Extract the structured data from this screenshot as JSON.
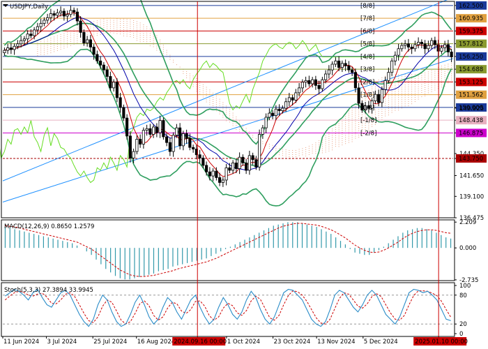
{
  "header": {
    "symbol_title": "USDJPY,Daily",
    "macd_label": "MACD(12,26,9) 0.8650 1.2579",
    "stoch_label": "Stoch(5,3,3) 27.3894 33.9945"
  },
  "colors": {
    "candle": "#000000",
    "bb": "#2e9e5e",
    "ma_fast": "#cc0000",
    "ma_slow": "#0000aa",
    "channel": "#1e90ff",
    "chikou": "#66dd22",
    "cloud": "#e8a080",
    "macd_hist": "#3399aa",
    "macd_signal": "#cc0000",
    "stoch_main": "#2a8cc8",
    "stoch_signal": "#cc0000",
    "vline": "#cc0000"
  },
  "chart_data": [
    {
      "type": "candlestick",
      "title": "USDJPY,Daily",
      "ylim": [
        136.475,
        163.0
      ],
      "price_ticks": [
        "162.500",
        "160.935",
        "159.375",
        "157.812",
        "156.250",
        "154.688",
        "153.125",
        "151.562",
        "150.000",
        "149.925",
        "148.438",
        "146.875",
        "144.350",
        "143.750",
        "141.650",
        "139.100",
        "136.475"
      ],
      "x_ticks": [
        "11 Jun 2024",
        "3 Jul 2024",
        "25 Jul 2024",
        "16 Aug 2024",
        "2024.09.16 00:00",
        "1 Oct 2024",
        "23 Oct 2024",
        "13 Nov 2024",
        "5 Dec 2024",
        "2025.01.10 00:00"
      ],
      "highlighted_times": [
        "2024.09.16 00:00",
        "2025.01.10 00:00"
      ],
      "highlighted_price": "156.250",
      "murrey_levels": [
        {
          "label": "[8/8]",
          "price": 162.5,
          "price_label": "162.500",
          "color": "#1a3a9a"
        },
        {
          "label": "[7/8]",
          "price": 160.935,
          "price_label": "160.935",
          "color": "#e0a040"
        },
        {
          "label": "[6/8]",
          "price": 159.375,
          "price_label": "159.375",
          "color": "#cc0000"
        },
        {
          "label": "[5/8]",
          "price": 157.812,
          "price_label": "157.812",
          "color": "#8a9a30"
        },
        {
          "label": "[4/8]",
          "price": 156.25,
          "price_label": "156.250",
          "color": "#1a3a9a"
        },
        {
          "label": "[3/8]",
          "price": 154.688,
          "price_label": "154.688",
          "color": "#8a9a30"
        },
        {
          "label": "[2/8]",
          "price": 153.125,
          "price_label": "153.125",
          "color": "#cc0000"
        },
        {
          "label": "[1/8]",
          "price": 151.562,
          "price_label": "151.562",
          "color": "#e0a040"
        },
        {
          "label": "[0/8]",
          "price": 150.0,
          "price_label": "150.000",
          "color": "#1a3a9a"
        },
        {
          "label": "[-1/8]",
          "price": 148.438,
          "price_label": "148.438",
          "color": "#e8b0c0"
        },
        {
          "label": "[-2/8]",
          "price": 146.875,
          "price_label": "146.875",
          "color": "#cc00cc"
        },
        {
          "label": "",
          "price": 143.75,
          "price_label": "143.750",
          "color": "#aa0000"
        }
      ],
      "closes": [
        157.0,
        157.3,
        157.1,
        157.5,
        157.8,
        158.2,
        158.4,
        159.0,
        158.8,
        159.5,
        159.9,
        160.3,
        160.7,
        161.0,
        161.5,
        161.3,
        161.6,
        161.8,
        161.2,
        161.4,
        161.9,
        161.7,
        160.6,
        159.2,
        157.9,
        158.3,
        157.4,
        156.5,
        155.7,
        155.2,
        154.6,
        153.8,
        152.4,
        153.1,
        151.2,
        150.0,
        148.7,
        146.5,
        143.8,
        144.6,
        146.1,
        145.5,
        147.2,
        147.4,
        146.7,
        147.6,
        146.9,
        148.4,
        146.4,
        145.7,
        144.6,
        146.6,
        147.5,
        145.3,
        146.8,
        146.2,
        145.1,
        144.9,
        144.2,
        143.8,
        142.9,
        142.1,
        141.6,
        142.2,
        141.4,
        140.8,
        141.1,
        142.6,
        142.3,
        143.2,
        142.5,
        143.9,
        143.2,
        142.3,
        144.1,
        143.6,
        142.7,
        146.7,
        147.5,
        148.8,
        149.3,
        149.0,
        149.8,
        149.6,
        149.9,
        150.7,
        151.2,
        150.9,
        151.8,
        152.4,
        153.1,
        153.3,
        152.9,
        153.4,
        152.7,
        152.3,
        153.4,
        154.1,
        154.6,
        155.3,
        155.7,
        154.9,
        155.4,
        155.1,
        154.6,
        154.3,
        152.4,
        150.5,
        149.7,
        150.2,
        149.9,
        150.8,
        151.6,
        150.6,
        152.2,
        153.3,
        154.3,
        155.7,
        156.4,
        157.2,
        157.6,
        157.8,
        157.4,
        157.2,
        157.7,
        158.0,
        157.8,
        157.2,
        157.6,
        158.2,
        157.7,
        156.9,
        157.3,
        157.7,
        156.8,
        156.2
      ],
      "series": [
        {
          "name": "Bollinger upper",
          "color": "#2e9e5e"
        },
        {
          "name": "Bollinger middle",
          "color": "#2e9e5e"
        },
        {
          "name": "Bollinger lower",
          "color": "#2e9e5e"
        },
        {
          "name": "Moving average fast",
          "color": "#cc0000"
        },
        {
          "name": "Moving average slow",
          "color": "#0000aa"
        },
        {
          "name": "Lagging line",
          "color": "#66dd22"
        },
        {
          "name": "Cloud",
          "color": "#e8a080"
        }
      ]
    },
    {
      "type": "bar",
      "title": "MACD(12,26,9) 0.8650 1.2579",
      "ylim": [
        -2.8,
        2.4
      ],
      "ticks": [
        "2.209",
        "0.000",
        "-2.735"
      ],
      "series": [
        {
          "name": "MACD",
          "values": [
            1.8,
            1.7,
            1.6,
            1.5,
            1.4,
            1.3,
            1.2,
            1.1,
            1.0,
            0.9,
            0.8,
            0.7,
            0.6,
            0.5,
            0.4,
            0.2,
            0.0,
            -0.3,
            -0.6,
            -1.0,
            -1.4,
            -1.8,
            -2.1,
            -2.4,
            -2.6,
            -2.7,
            -2.7,
            -2.6,
            -2.5,
            -2.4,
            -2.3,
            -2.2,
            -2.0,
            -1.9,
            -1.8,
            -1.6,
            -1.5,
            -1.4,
            -1.3,
            -1.2,
            -1.1,
            -1.0,
            -0.9,
            -0.7,
            -0.5,
            -0.3,
            -0.1,
            0.1,
            0.3,
            0.5,
            0.7,
            0.9,
            1.1,
            1.3,
            1.5,
            1.7,
            1.9,
            2.0,
            2.1,
            2.2,
            2.2,
            2.2,
            2.1,
            2.0,
            1.9,
            1.8,
            1.6,
            1.4,
            1.2,
            0.9,
            0.6,
            0.3,
            -0.1,
            -0.4,
            -0.5,
            -0.6,
            -0.6,
            -0.4,
            -0.2,
            0.1,
            0.4,
            0.7,
            1.0,
            1.3,
            1.5,
            1.6,
            1.7,
            1.7,
            1.6,
            1.5,
            1.3,
            1.1,
            0.9,
            0.8
          ]
        },
        {
          "name": "Signal",
          "values": [
            1.9,
            1.85,
            1.8,
            1.7,
            1.6,
            1.5,
            1.4,
            1.3,
            1.2,
            1.1,
            1.0,
            0.9,
            0.8,
            0.7,
            0.6,
            0.5,
            0.3,
            0.1,
            -0.1,
            -0.4,
            -0.7,
            -1.0,
            -1.3,
            -1.6,
            -1.9,
            -2.1,
            -2.3,
            -2.4,
            -2.45,
            -2.45,
            -2.4,
            -2.35,
            -2.25,
            -2.15,
            -2.05,
            -1.95,
            -1.8,
            -1.7,
            -1.6,
            -1.5,
            -1.4,
            -1.3,
            -1.2,
            -1.05,
            -0.9,
            -0.7,
            -0.5,
            -0.3,
            -0.1,
            0.1,
            0.3,
            0.5,
            0.7,
            0.9,
            1.1,
            1.3,
            1.5,
            1.7,
            1.85,
            1.95,
            2.05,
            2.1,
            2.1,
            2.05,
            2.0,
            1.95,
            1.85,
            1.7,
            1.55,
            1.35,
            1.1,
            0.85,
            0.55,
            0.25,
            0.0,
            -0.2,
            -0.35,
            -0.4,
            -0.35,
            -0.2,
            0.0,
            0.25,
            0.5,
            0.8,
            1.05,
            1.25,
            1.4,
            1.5,
            1.55,
            1.55,
            1.5,
            1.4,
            1.3,
            1.25
          ]
        }
      ]
    },
    {
      "type": "line",
      "title": "Stoch(5,3,3) 27.3894 33.9945",
      "ylim": [
        0,
        100
      ],
      "ticks": [
        "100",
        "80",
        "20",
        "0"
      ],
      "series": [
        {
          "name": "%K",
          "values": [
            78,
            85,
            92,
            88,
            80,
            70,
            85,
            92,
            75,
            60,
            55,
            70,
            85,
            90,
            80,
            60,
            40,
            25,
            15,
            30,
            60,
            80,
            70,
            45,
            25,
            15,
            20,
            40,
            65,
            80,
            60,
            35,
            20,
            30,
            55,
            75,
            65,
            45,
            30,
            50,
            70,
            80,
            55,
            35,
            20,
            30,
            55,
            75,
            60,
            40,
            30,
            45,
            70,
            88,
            75,
            50,
            30,
            20,
            35,
            60,
            85,
            92,
            90,
            80,
            70,
            50,
            30,
            20,
            15,
            25,
            50,
            80,
            90,
            85,
            70,
            55,
            45,
            60,
            80,
            90,
            80,
            60,
            40,
            30,
            20,
            35,
            60,
            85,
            92,
            90,
            85,
            88,
            80,
            70,
            50,
            30,
            27
          ]
        },
        {
          "name": "%D",
          "values": [
            70,
            78,
            85,
            88,
            86,
            80,
            78,
            82,
            84,
            76,
            63,
            62,
            70,
            82,
            85,
            77,
            60,
            42,
            27,
            23,
            35,
            57,
            70,
            65,
            47,
            28,
            20,
            25,
            42,
            62,
            68,
            58,
            38,
            28,
            35,
            53,
            65,
            62,
            47,
            42,
            50,
            67,
            68,
            57,
            37,
            28,
            35,
            53,
            63,
            58,
            43,
            38,
            48,
            68,
            78,
            71,
            52,
            33,
            28,
            38,
            60,
            79,
            89,
            87,
            80,
            67,
            50,
            33,
            22,
            20,
            30,
            52,
            73,
            85,
            82,
            70,
            57,
            53,
            62,
            77,
            83,
            77,
            60,
            43,
            30,
            28,
            38,
            60,
            79,
            89,
            89,
            88,
            84,
            79,
            67,
            50,
            34
          ]
        }
      ]
    }
  ]
}
